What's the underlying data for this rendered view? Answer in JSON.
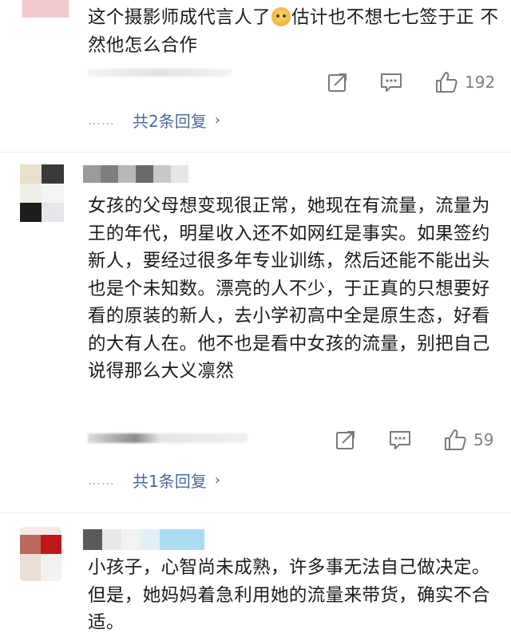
{
  "comments": [
    {
      "text_parts": [
        "这个摄影师成代言人了",
        "估计也不想七七签于正 不然他怎么合作"
      ],
      "emoji": "smirk-emoji",
      "likes": "192",
      "reply_link": "共2条回复"
    },
    {
      "text": "女孩的父母想变现很正常，她现在有流量，流量为王的年代，明星收入还不如网红是事实。如果签约新人，要经过很多年专业训练，然后还能不能出头也是个未知数。漂亮的人不少，于正真的只想要好看的原装的新人，去小学初高中全是原生态，好看的大有人在。他不也是看中女孩的流量，别把自己说得那么大义凛然",
      "likes": "59",
      "reply_link": "共1条回复"
    },
    {
      "text": "小孩子，心智尚未成熟，许多事无法自己做决定。但是，她妈妈着急利用她的流量来带货，确实不合适。"
    }
  ],
  "reply_dots": "……",
  "chevron": "›",
  "colors": {
    "link": "#4a6a9a",
    "meta": "#808080",
    "text": "#1b1b1b"
  }
}
